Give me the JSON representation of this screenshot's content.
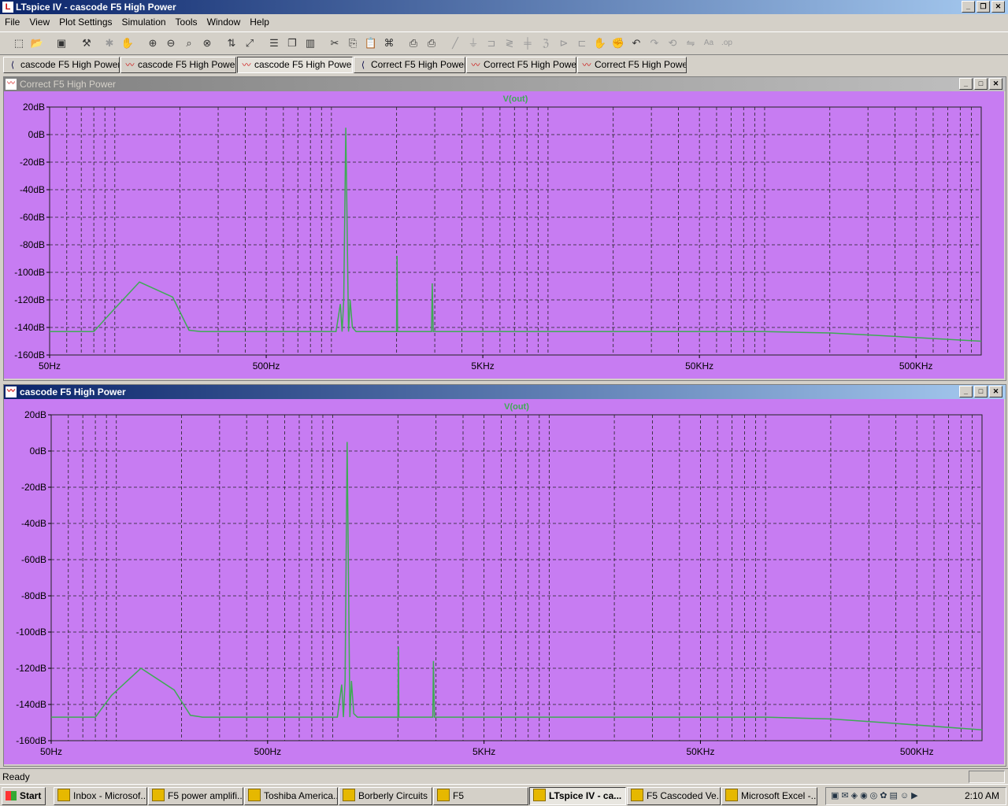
{
  "window": {
    "title": "LTspice IV - cascode F5 High Power"
  },
  "menu": [
    "File",
    "View",
    "Plot Settings",
    "Simulation",
    "Tools",
    "Window",
    "Help"
  ],
  "toolbar_icons": [
    "new-schematic-icon",
    "open-icon",
    "save-icon",
    "control-panel-icon",
    "run-icon",
    "halt-icon",
    "zoom-in-icon",
    "zoom-out-icon",
    "zoom-area-icon",
    "zoom-cancel-icon",
    "autorange-icon",
    "zoom-fit-icon",
    "tile-horizontal-icon",
    "cascade-icon",
    "tile-vertical-icon",
    "cut-icon",
    "copy-icon",
    "paste-icon",
    "find-icon",
    "print-preview-icon",
    "print-icon",
    "wire-icon",
    "ground-icon",
    "label-icon",
    "resistor-icon",
    "capacitor-icon",
    "inductor-icon",
    "diode-icon",
    "component-icon",
    "move-icon",
    "drag-icon",
    "undo-icon",
    "redo-icon",
    "rotate-icon",
    "mirror-icon",
    "text-icon",
    "spice-directive-icon"
  ],
  "tabs": [
    {
      "label": "cascode F5 High Power",
      "kind": "schematic"
    },
    {
      "label": "cascode F5 High Power",
      "kind": "plot"
    },
    {
      "label": "cascode F5 High Power",
      "kind": "plot"
    },
    {
      "label": "Correct F5 High Power",
      "kind": "schematic"
    },
    {
      "label": "Correct F5 High Power",
      "kind": "plot"
    },
    {
      "label": "Correct F5 High Power",
      "kind": "plot"
    }
  ],
  "panes": [
    {
      "title": "Correct F5 High Power"
    },
    {
      "title": "cascode F5 High Power"
    }
  ],
  "chart_data": [
    {
      "type": "line",
      "trace": "V(out)",
      "xscale": "log",
      "xlim": [
        50,
        1000000
      ],
      "ylim": [
        -160,
        20
      ],
      "ylabel_unit": "dB",
      "yticks": [
        "20dB",
        "0dB",
        "-20dB",
        "-40dB",
        "-60dB",
        "-80dB",
        "-100dB",
        "-120dB",
        "-140dB",
        "-160dB"
      ],
      "xticks": [
        "50Hz",
        "500Hz",
        "5KHz",
        "50KHz",
        "500KHz"
      ],
      "grid": true,
      "colors": {
        "background": "#c77cf2",
        "trace": "#3faa55",
        "grid": "#222222"
      },
      "series": [
        {
          "x": [
            50,
            80,
            95,
            130,
            185,
            220,
            250,
            1000,
            1050,
            1100,
            1120,
            1140,
            1165,
            1200,
            1220,
            1250,
            1300,
            1350,
            1600,
            2000,
            2010,
            2020,
            2050,
            2900,
            2920,
            2950,
            3000,
            5000,
            100000,
            200000,
            350000,
            1000000
          ],
          "y": [
            -143,
            -143,
            -130,
            -107,
            -118,
            -142,
            -143,
            -143,
            -143,
            -123,
            -143,
            -120,
            5,
            -143,
            -120,
            -140,
            -143,
            -143,
            -143,
            -143,
            -88,
            -143,
            -143,
            -143,
            -108,
            -143,
            -143,
            -143,
            -143,
            -144,
            -146,
            -150
          ]
        }
      ]
    },
    {
      "type": "line",
      "trace": "V(out)",
      "xscale": "log",
      "xlim": [
        50,
        1000000
      ],
      "ylim": [
        -160,
        20
      ],
      "ylabel_unit": "dB",
      "yticks": [
        "20dB",
        "0dB",
        "-20dB",
        "-40dB",
        "-60dB",
        "-80dB",
        "-100dB",
        "-120dB",
        "-140dB",
        "-160dB"
      ],
      "xticks": [
        "50Hz",
        "500Hz",
        "5KHz",
        "50KHz",
        "500KHz"
      ],
      "grid": true,
      "colors": {
        "background": "#c77cf2",
        "trace": "#3faa55",
        "grid": "#222222"
      },
      "series": [
        {
          "x": [
            50,
            80,
            95,
            130,
            185,
            220,
            250,
            1000,
            1050,
            1100,
            1120,
            1140,
            1165,
            1200,
            1220,
            1250,
            1300,
            1350,
            1600,
            2000,
            2010,
            2020,
            2050,
            2900,
            2920,
            2950,
            3000,
            5000,
            100000,
            200000,
            350000,
            1000000
          ],
          "y": [
            -147,
            -147,
            -135,
            -120,
            -132,
            -146,
            -147,
            -147,
            -147,
            -129,
            -147,
            -127,
            5,
            -147,
            -127,
            -145,
            -147,
            -147,
            -147,
            -147,
            -108,
            -147,
            -147,
            -147,
            -116,
            -147,
            -147,
            -147,
            -147,
            -148,
            -150,
            -154
          ]
        }
      ]
    }
  ],
  "status": {
    "text": "Ready"
  },
  "taskbar": {
    "start": "Start",
    "tasks": [
      "Inbox - Microsof...",
      "F5 power amplifi...",
      "Toshiba America...",
      "Borberly Circuits",
      "F5",
      "LTspice IV - ca...",
      "F5 Cascoded Ve...",
      "Microsoft Excel -..."
    ],
    "active_index": 5,
    "clock": "2:10 AM"
  }
}
